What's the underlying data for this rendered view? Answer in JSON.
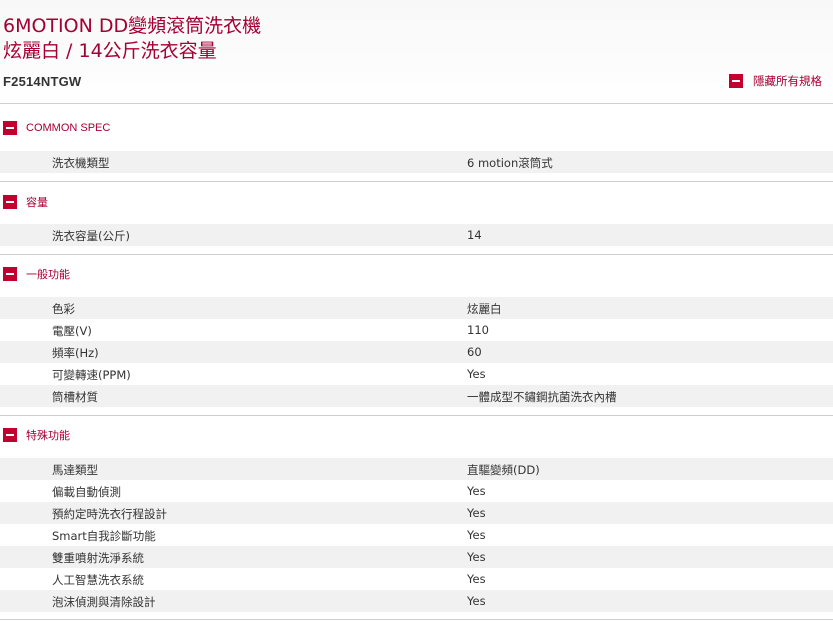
{
  "header": {
    "title_line1": "6MOTION DD變頻滾筒洗衣機",
    "title_line2": "炫麗白 / 14公斤洗衣容量",
    "model": "F2514NTGW",
    "hide_all_label": "隱藏所有規格"
  },
  "sections": [
    {
      "title": "COMMON SPEC",
      "rows": [
        {
          "label": "洗衣機類型",
          "value": "6 motion滾筒式"
        }
      ]
    },
    {
      "title": "容量",
      "rows": [
        {
          "label": "洗衣容量(公斤)",
          "value": "14"
        }
      ]
    },
    {
      "title": "一般功能",
      "rows": [
        {
          "label": "色彩",
          "value": "炫麗白"
        },
        {
          "label": "電壓(V)",
          "value": "110"
        },
        {
          "label": "頻率(Hz)",
          "value": "60"
        },
        {
          "label": "可變轉速(PPM)",
          "value": "Yes"
        },
        {
          "label": "筒槽材質",
          "value": "一體成型不鏽鋼抗菌洗衣內槽"
        }
      ]
    },
    {
      "title": "特殊功能",
      "rows": [
        {
          "label": "馬達類型",
          "value": "直驅變頻(DD)"
        },
        {
          "label": "偏載自動偵測",
          "value": "Yes"
        },
        {
          "label": "預約定時洗衣行程設計",
          "value": "Yes"
        },
        {
          "label": "Smart自我診斷功能",
          "value": "Yes"
        },
        {
          "label": "雙重噴射洗淨系統",
          "value": "Yes"
        },
        {
          "label": "人工智慧洗衣系統",
          "value": "Yes"
        },
        {
          "label": "泡沫偵測與清除設計",
          "value": "Yes"
        }
      ]
    }
  ]
}
